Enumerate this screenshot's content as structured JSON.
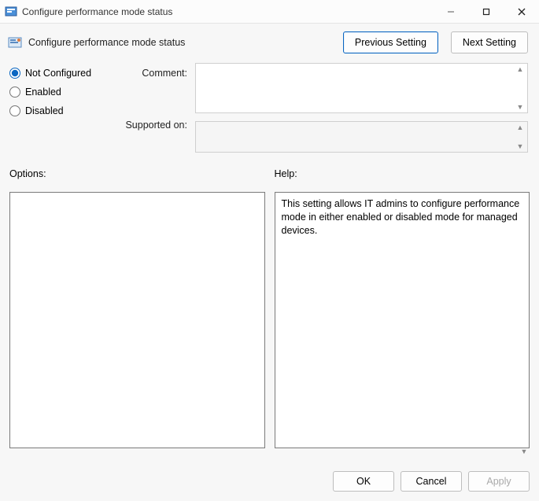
{
  "window": {
    "title": "Configure performance mode status"
  },
  "header": {
    "policy_title": "Configure performance mode status",
    "previous_label": "Previous Setting",
    "next_label": "Next Setting"
  },
  "radio": {
    "not_configured": "Not Configured",
    "enabled": "Enabled",
    "disabled": "Disabled",
    "selected": "not_configured"
  },
  "labels": {
    "comment": "Comment:",
    "supported": "Supported on:",
    "options": "Options:",
    "help": "Help:"
  },
  "fields": {
    "comment_value": "",
    "supported_value": ""
  },
  "help": {
    "text": "This setting allows IT admins to configure performance mode in either enabled or disabled mode for managed devices."
  },
  "footer": {
    "ok": "OK",
    "cancel": "Cancel",
    "apply": "Apply"
  }
}
